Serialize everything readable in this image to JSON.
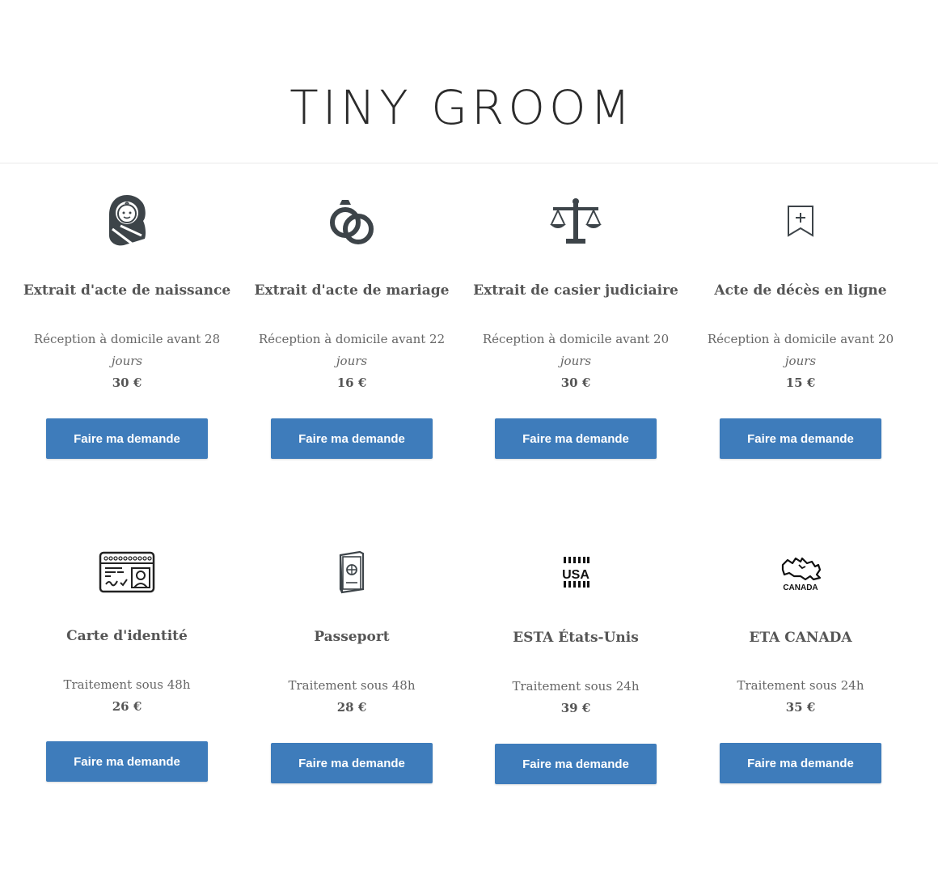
{
  "site": {
    "title": "TINY GROOM"
  },
  "button_label": "Faire ma demande",
  "accent_color": "#3e7cbb",
  "row1": [
    {
      "icon": "baby-icon",
      "title": "Extrait d'acte de naissance",
      "delivery": "Réception à domicile avant 28",
      "delivery_unit": "jours",
      "price": "30 €"
    },
    {
      "icon": "wedding-rings-icon",
      "title": "Extrait d'acte de mariage",
      "delivery": "Réception à domicile avant 22",
      "delivery_unit": "jours",
      "price": "16 €"
    },
    {
      "icon": "scales-of-justice-icon",
      "title": "Extrait de casier judiciaire",
      "delivery": "Réception à domicile avant 20",
      "delivery_unit": "jours",
      "price": "30 €"
    },
    {
      "icon": "bookmark-cross-icon",
      "title": "Acte de décès en ligne",
      "delivery": "Réception à domicile avant 20",
      "delivery_unit": "jours",
      "price": "15 €"
    }
  ],
  "row2": [
    {
      "icon": "id-card-icon",
      "title": "Carte d'identité",
      "delivery": "Traitement sous 48h",
      "price": "26 €"
    },
    {
      "icon": "passport-icon",
      "title": "Passeport",
      "delivery": "Traitement sous 48h",
      "price": "28 €"
    },
    {
      "icon": "usa-icon",
      "title": "ESTA États-Unis",
      "delivery": "Traitement sous 24h",
      "price": "39 €",
      "icon_text": "USA"
    },
    {
      "icon": "canada-map-icon",
      "title": "ETA CANADA",
      "delivery": "Traitement sous 24h",
      "price": "35 €",
      "icon_text": "CANADA"
    }
  ]
}
